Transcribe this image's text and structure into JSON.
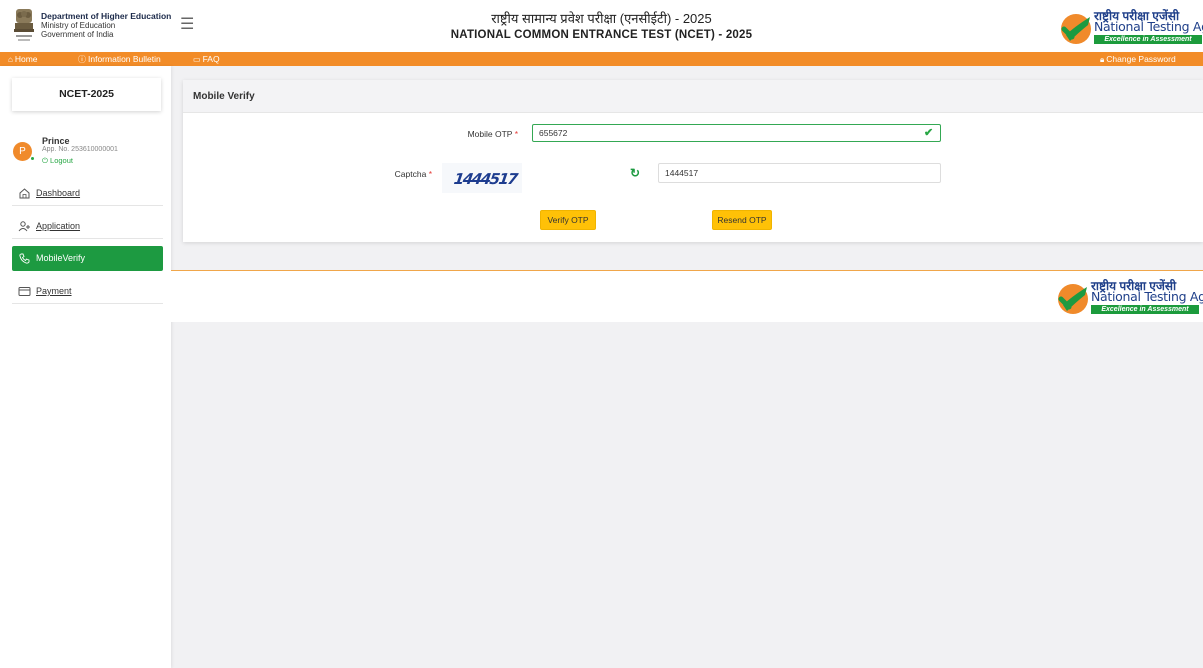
{
  "header": {
    "dept_line1": "Department of Higher Education",
    "dept_line2": "Ministry of Education",
    "dept_line3": "Government of India",
    "title_hindi": "राष्ट्रीय सामान्य प्रवेश परीक्षा (एनसीईटी) - 2025",
    "title_english": "NATIONAL COMMON ENTRANCE TEST (NCET) - 2025",
    "nta_hindi": "राष्ट्रीय परीक्षा एजेंसी",
    "nta_english": "National Testing Agency",
    "nta_tagline": "Excellence in Assessment"
  },
  "navbar": {
    "home": "Home",
    "info_bulletin": "Information Bulletin",
    "faq": "FAQ",
    "change_password": "Change Password"
  },
  "sidebar": {
    "exam": "NCET-2025",
    "avatar_letter": "P",
    "user_name": "Prince",
    "app_no": "App. No. 253610000001",
    "logout": "Logout",
    "items": [
      {
        "label": "Dashboard",
        "icon": "home-icon"
      },
      {
        "label": "Application",
        "icon": "user-add-icon"
      },
      {
        "label": "MobileVerify",
        "icon": "phone-icon"
      },
      {
        "label": "Payment",
        "icon": "card-icon"
      }
    ]
  },
  "form": {
    "card_title": "Mobile Verify",
    "otp_label": "Mobile OTP",
    "otp_value": "655672",
    "captcha_label": "Captcha",
    "captcha_image_text": "1444517",
    "captcha_value": "1444517",
    "verify_button": "Verify OTP",
    "resend_button": "Resend OTP",
    "required_mark": "*"
  },
  "colors": {
    "orange": "#f28c28",
    "green": "#1d9a41",
    "button": "#ffc107"
  }
}
